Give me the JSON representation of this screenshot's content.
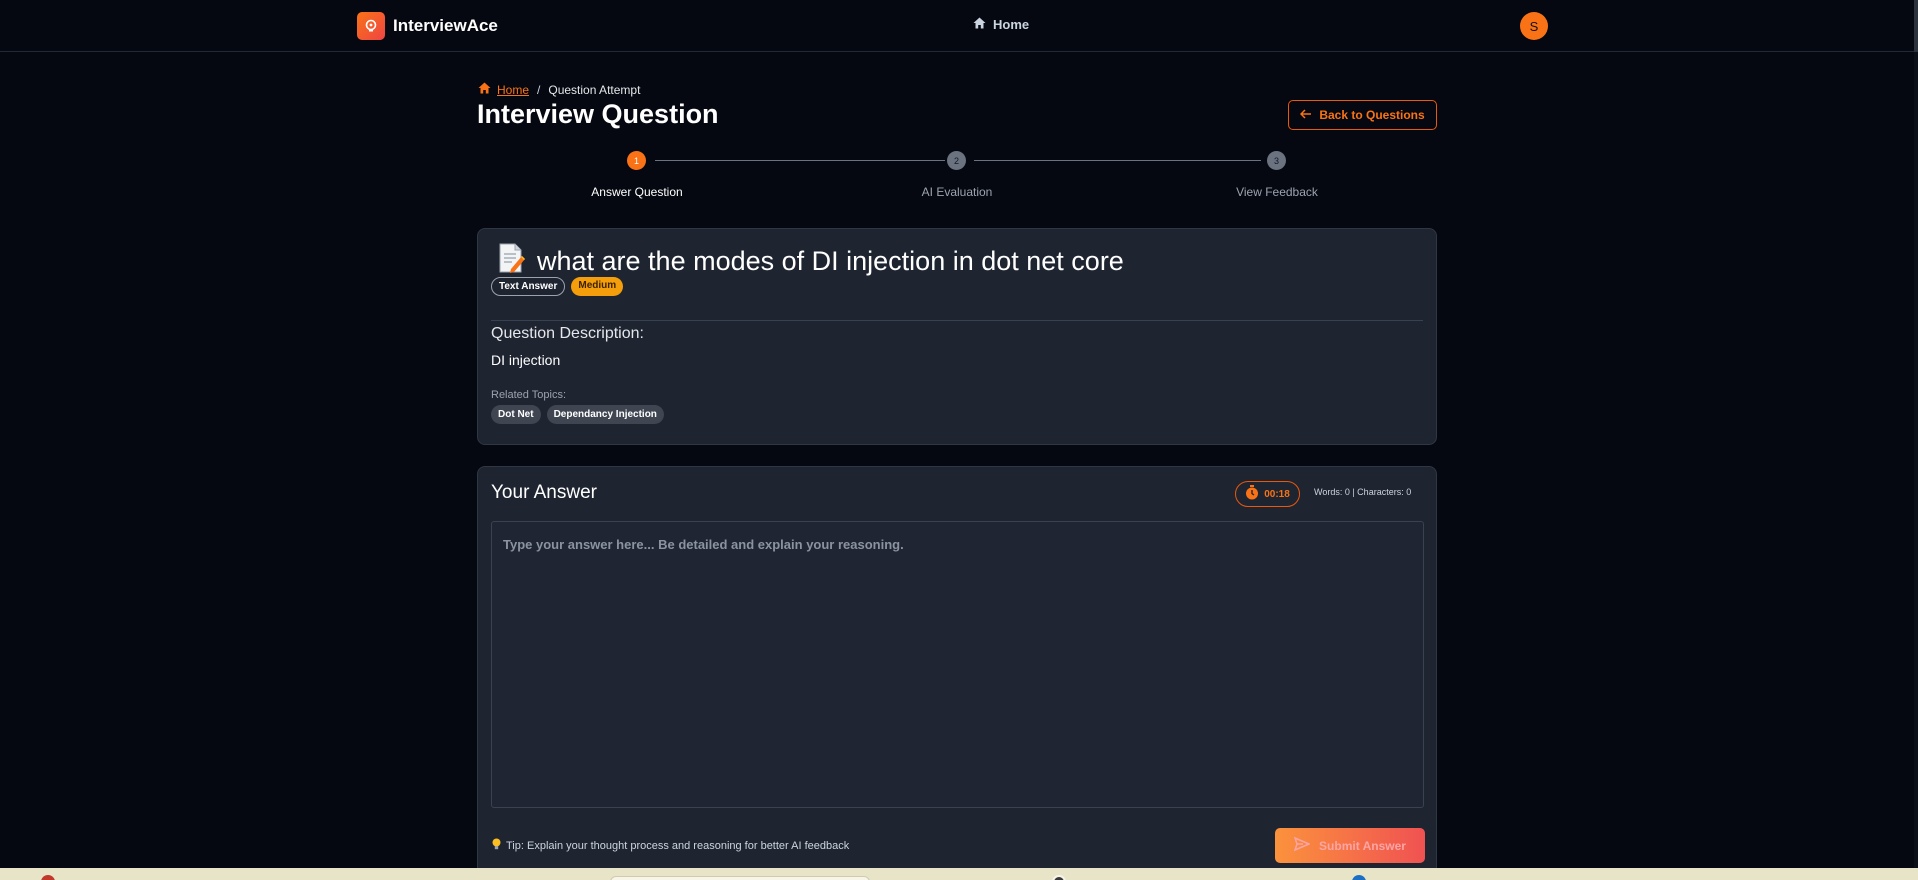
{
  "nav": {
    "brand": "InterviewAce",
    "home": "Home",
    "avatar_initial": "S"
  },
  "breadcrumb": {
    "home": "Home",
    "separator": "/",
    "current": "Question Attempt"
  },
  "page": {
    "title": "Interview Question",
    "back_button": "Back to Questions"
  },
  "stepper": {
    "steps": [
      {
        "number": "1",
        "label": "Answer Question",
        "state": "active"
      },
      {
        "number": "2",
        "label": "AI Evaluation",
        "state": "pending"
      },
      {
        "number": "3",
        "label": "View Feedback",
        "state": "pending"
      }
    ]
  },
  "question": {
    "title": "what are the modes of DI injection in dot net core",
    "type_badge": "Text Answer",
    "difficulty_badge": "Medium",
    "description_label": "Question Description:",
    "description": "DI injection",
    "topics_label": "Related Topics:",
    "topics": [
      "Dot Net",
      "Dependancy Injection"
    ]
  },
  "answer": {
    "title": "Your Answer",
    "timer": "00:18",
    "counts": "Words: 0 | Characters: 0",
    "value": "",
    "placeholder": "Type your answer here... Be detailed and explain your reasoning.",
    "tip": "Tip: Explain your thought process and reasoning for better AI feedback",
    "submit": "Submit Answer"
  },
  "colors": {
    "accent": "#f97316",
    "background": "#050810",
    "card": "#1e2430",
    "medium_badge": "#f59e0b"
  },
  "icons": {
    "brand": "lightbulb-head-icon",
    "home": "home-icon",
    "back": "arrow-left-icon",
    "question": "memo-icon",
    "timer": "stopwatch-icon",
    "tip": "lightbulb-icon",
    "submit": "send-icon"
  }
}
